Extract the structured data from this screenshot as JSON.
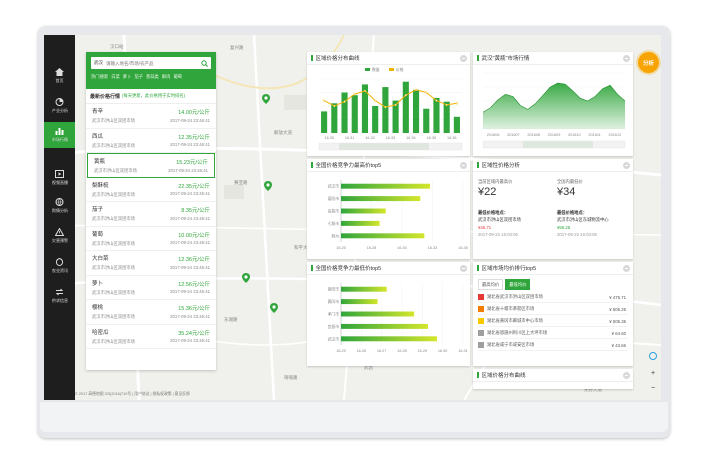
{
  "sidebar": {
    "items": [
      {
        "label": "首页",
        "icon": "home-icon"
      },
      {
        "label": "产业分析",
        "icon": "pie-chart-icon"
      },
      {
        "label": "市场行情",
        "icon": "bar-chart-icon"
      },
      {
        "label": "视频直播",
        "icon": "video-icon"
      },
      {
        "label": "舆情分析",
        "icon": "globe-icon"
      },
      {
        "label": "灾害预警",
        "icon": "warning-icon"
      },
      {
        "label": "农业资讯",
        "icon": "news-icon"
      },
      {
        "label": "供求信息",
        "icon": "exchange-icon"
      }
    ],
    "active_index": 2,
    "colors": {
      "bg": "#1e1e1e",
      "active": "#2fa53b"
    }
  },
  "search": {
    "city": "武汉",
    "placeholder": "请输入地名/市场/农产品",
    "quick_label": "热门搜索",
    "categories": [
      "白菜",
      "萝卜",
      "茄子",
      "葱蒜类",
      "鲜肉",
      "葡萄"
    ]
  },
  "price_list": {
    "title": "最新价格行情",
    "subtitle": "(每天更新，此价格用于实时排名)",
    "items": [
      {
        "name": "青辛",
        "price": "14.00元/公斤",
        "market": "武汉市洪山区双团市场",
        "time": "2017-09-24 23:46:41"
      },
      {
        "name": "西瓜",
        "price": "12.35元/公斤",
        "market": "武汉市洪山区双团市场",
        "time": "2017-09-24 23:46:41"
      },
      {
        "name": "黄瓶",
        "price": "15.23元/公斤",
        "market": "武汉市洪山区双团市场",
        "time": "2017-09-24 23:46:41"
      },
      {
        "name": "梨酥梳",
        "price": "22.35元/公斤",
        "market": "武汉市洪山区双团市场",
        "time": "2017-09-24 23:46:41"
      },
      {
        "name": "茄子",
        "price": "8.35元/公斤",
        "market": "武汉市洪山区双团市场",
        "time": "2017-09-24 23:46:41"
      },
      {
        "name": "葡萄",
        "price": "10.00元/公斤",
        "market": "武汉市洪山区双团市场",
        "time": "2017-09-24 23:46:41"
      },
      {
        "name": "大白菜",
        "price": "12.36元/公斤",
        "market": "武汉市洪山区双团市场",
        "time": "2017-09-24 23:46:41"
      },
      {
        "name": "萝卜",
        "price": "12.56元/公斤",
        "market": "武汉市洪山区双团市场",
        "time": "2017-09-24 23:46:41"
      },
      {
        "name": "樱桃",
        "price": "15.36元/公斤",
        "market": "武汉市洪山区双团市场",
        "time": "2017-09-24 23:46:41"
      },
      {
        "name": "哈密瓜",
        "price": "35.24元/公斤",
        "market": "武汉市洪山区双团市场",
        "time": "2017-09-24 23:46:41"
      }
    ],
    "selected_index": 2
  },
  "cards": {
    "dist_curve_title": "区域价格分布曲线",
    "trend_title": "武汉\"黄瓶\"市场行情",
    "competition_max_title": "全国价格竞争力最高价top5",
    "analysis_title": "区域性价格分析",
    "competition_min_title": "全国价格竞争力最低价top5",
    "rank_title": "区域市场均价排行top5",
    "bottom_title": "区域价格分布曲线"
  },
  "analysis": {
    "max": {
      "label": "当前区域内最高价",
      "value": "¥22",
      "market_label": "最低价格地点：",
      "market": "武汉市洪山区双团市场",
      "price": "¥45.71",
      "time": "2017-09-22 16:03:06"
    },
    "min": {
      "label": "全国内最低价",
      "value": "¥34",
      "market_label": "最低价格地点：",
      "market": "武汉市洪山区东城物流中心",
      "price": "¥56.25",
      "time": "2017-09-22 16:03:06"
    }
  },
  "rank": {
    "tabs": [
      "最高均价",
      "最低均价"
    ],
    "active_tab": 1,
    "rows": [
      {
        "name": "湖北省武汉市洪山区双团市场",
        "price": "¥ 475.71",
        "color": "#e53935"
      },
      {
        "name": "湖北省十堰市茅箭区市场",
        "price": "¥ 506.25",
        "color": "#f57c00"
      },
      {
        "name": "湖北省黄冈市麻城市中心市场",
        "price": "¥ 505.35",
        "color": "#f9c800"
      },
      {
        "name": "湖北省恩施州利川区上大坪市场",
        "price": "¥ 64.60",
        "color": "#9e9e9e"
      },
      {
        "name": "湖北省咸宁市咸安区市场",
        "price": "¥ 43.66",
        "color": "#9e9e9e"
      }
    ]
  },
  "analysis_btn": "分析",
  "map_labels": [
    "汉口站",
    "复兴路",
    "解放大道",
    "赛亚路",
    "和平大道",
    "东湖路",
    "珞喻路",
    "武昌",
    "光谷大道"
  ],
  "footer_text": "© 2017 高德地图 GS(2016)710号 | 用户协议 | 隐私权政策 | 意见反馈",
  "zoom": {
    "in": "+",
    "out": "−"
  },
  "chart_data": [
    {
      "type": "bar",
      "title": "区域价格分布曲线",
      "series": [
        {
          "name": "数量",
          "values": [
            40,
            55,
            75,
            70,
            90,
            50,
            85,
            60,
            95,
            80,
            45,
            65,
            58,
            30
          ]
        },
        {
          "name": "价格",
          "values": [
            60,
            50,
            58,
            72,
            78,
            60,
            48,
            52,
            70,
            80,
            75,
            60,
            52,
            55
          ]
        }
      ],
      "categories": [
        "1",
        "2",
        "3",
        "4",
        "5",
        "6",
        "7",
        "8",
        "9",
        "10",
        "11",
        "12",
        "13",
        "14"
      ],
      "x_ticks": [
        "16.30",
        "16.31",
        "16.32",
        "16.33",
        "16.34",
        "16.35",
        "16.36"
      ],
      "colors": [
        "#2fa53b",
        "#f2b200"
      ]
    },
    {
      "type": "area",
      "title": "武汉\"黄瓶\"市场行情",
      "values": [
        30,
        38,
        52,
        62,
        58,
        42,
        35,
        45,
        60,
        75,
        82,
        80,
        68,
        55,
        50,
        58,
        72,
        78,
        62,
        50
      ],
      "x_ticks": [
        "201606",
        "201607",
        "201608",
        "201609",
        "201610",
        "201611",
        "201612"
      ],
      "color": "#2fa53b"
    },
    {
      "type": "bar",
      "orientation": "horizontal",
      "title": "全国价格竞争力最高价top5",
      "categories": [
        "武汉市",
        "襄阳市",
        "宜昌市",
        "七堰市",
        "荆州"
      ],
      "values": [
        16.38,
        15.9,
        14.2,
        13.9,
        16.1
      ],
      "x_ticks": [
        "16.25",
        "16.28",
        "16.30",
        "16.33",
        "16.35"
      ],
      "colors": [
        "#2fa53b",
        "#d4e62c"
      ]
    },
    {
      "type": "bar",
      "orientation": "horizontal",
      "title": "全国价格竞争力最低价top5",
      "categories": [
        "襄阳市",
        "黄冈市",
        "孝门市",
        "宜昌市",
        "武汉市"
      ],
      "values": [
        15.0,
        14.4,
        16.8,
        17.7,
        18.3
      ],
      "x_ticks": [
        "16.25",
        "16.26",
        "16.27",
        "16.28",
        "16.29",
        "16.30",
        "16.31"
      ],
      "colors": [
        "#2fa53b",
        "#d4e62c"
      ]
    }
  ]
}
